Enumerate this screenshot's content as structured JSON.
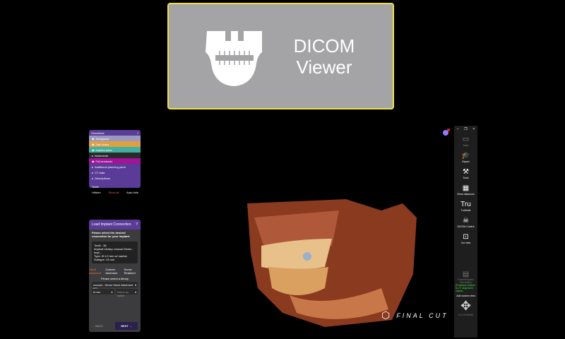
{
  "banner": {
    "title_line1": "DICOM",
    "title_line2": "Viewer"
  },
  "show_hide": {
    "title": "Show/hide",
    "items": [
      {
        "label": "Antagonist",
        "color": "#9a9ac0"
      },
      {
        "label": "Jaw scans",
        "color": "#e0a040"
      },
      {
        "label": "Implant parts",
        "color": "#40b0a0"
      },
      {
        "label": "Abutments",
        "color": "#2a2a2a"
      },
      {
        "label": "Full anatomic",
        "color": "#a0149a"
      },
      {
        "label": "Additional planning parts",
        "color": ""
      },
      {
        "label": "CT data",
        "color": ""
      },
      {
        "label": "Descriptions",
        "color": ""
      }
    ],
    "teeth": "Teeth",
    "hidden": "Hidden",
    "show_all": "Show all",
    "auto_hide": "Auto hide"
  },
  "implant": {
    "title": "Load Implant Connection",
    "prompt": "Please select the desired connection for your implant:",
    "tooth": "Tooth : 36",
    "library": "Implant Library: exocad Demo - Impl...",
    "type": "Type: Ø 4.0 mm w/ marker",
    "subtype": "Subtype: 13 mm",
    "tabs": [
      "Stock Abutment",
      "Custom Abutment",
      "Screw Retained"
    ],
    "select_library": "Please select a library",
    "library_value": "exocad - Demo Stock Abutment FO",
    "size_value": "8 mm",
    "option_placeholder": "Select an option",
    "back": "BACK",
    "next": "NEXT"
  },
  "toolbar": {
    "items": [
      {
        "label": "Save",
        "icon": "save-icon"
      },
      {
        "label": "Export",
        "icon": "export-icon"
      },
      {
        "label": "Tools",
        "icon": "tools-icon"
      },
      {
        "label": "Show distances",
        "icon": "distances-icon"
      },
      {
        "label": "TruSmile",
        "icon": "trusmile-icon"
      },
      {
        "label": "DICOM Control",
        "icon": "dicom-icon"
      },
      {
        "label": "Cut view",
        "icon": "cut-view-icon"
      }
    ],
    "expert_label": "Expert/Implant information",
    "status": "(Positions relative to CT alignment object)",
    "add_view": "Add custom view",
    "version": "v3.2-9036284"
  },
  "logo": "FINAL CUT"
}
